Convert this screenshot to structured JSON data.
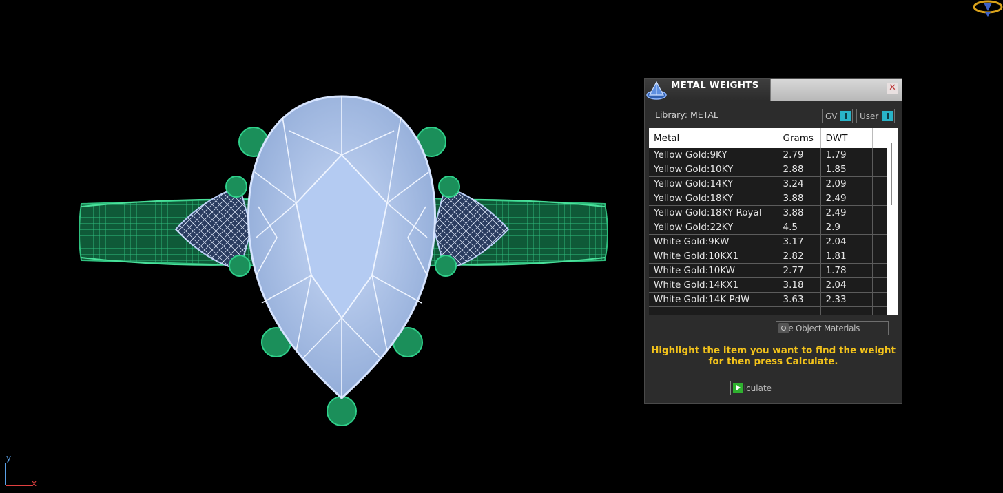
{
  "panel": {
    "title": "METAL WEIGHTS",
    "close_icon": "✕",
    "library_label": "Library: METAL",
    "gv_label": "GV",
    "user_label": "User",
    "columns": [
      "Metal",
      "Grams",
      "DWT"
    ],
    "rows": [
      [
        "Yellow Gold:9KY",
        "2.79",
        "1.79"
      ],
      [
        "Yellow Gold:10KY",
        "2.88",
        "1.85"
      ],
      [
        "Yellow Gold:14KY",
        "3.24",
        "2.09"
      ],
      [
        "Yellow Gold:18KY",
        "3.88",
        "2.49"
      ],
      [
        "Yellow Gold:18KY Royal",
        "3.88",
        "2.49"
      ],
      [
        "Yellow Gold:22KY",
        "4.5",
        "2.9"
      ],
      [
        "White Gold:9KW",
        "3.17",
        "2.04"
      ],
      [
        "White Gold:10KX1",
        "2.82",
        "1.81"
      ],
      [
        "White Gold:10KW",
        "2.77",
        "1.78"
      ],
      [
        "White Gold:14KX1",
        "3.18",
        "2.04"
      ],
      [
        "White Gold:14K PdW",
        "3.63",
        "2.33"
      ]
    ],
    "use_object_materials": "Use Object Materials",
    "hint_line1": "Highlight the item you want to find the weight",
    "hint_line2": "for then press Calculate.",
    "calculate_label": "Calculate"
  },
  "axes": {
    "y_label": "y",
    "x_label": "x"
  },
  "colors": {
    "stone": "#a8c4f0",
    "metal": "#1f8f5e",
    "accent": "#f2c21b",
    "toggle": "#29b3c8"
  }
}
